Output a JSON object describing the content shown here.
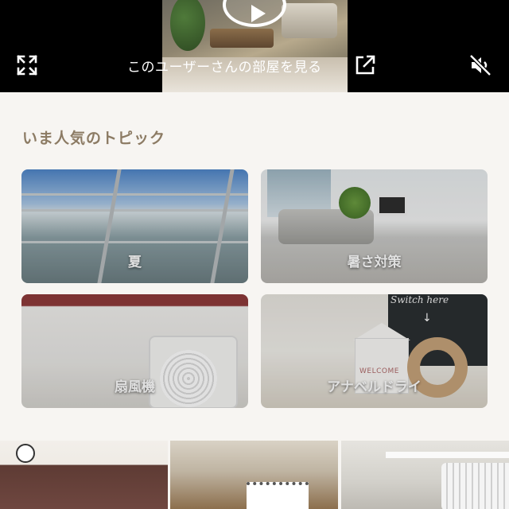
{
  "video": {
    "user_room_link_label": "このユーザーさんの部屋を見る",
    "expand_icon": "expand-icon",
    "external_link_icon": "external-link-icon",
    "mute_icon": "speaker-muted-icon",
    "play_icon": "play-icon"
  },
  "trending": {
    "title": "いま人気のトピック",
    "topics": [
      {
        "label": "夏"
      },
      {
        "label": "暑さ対策"
      },
      {
        "label": "扇風機"
      },
      {
        "label": "アナベルドライ"
      }
    ]
  },
  "tile_texts": {
    "board": "Switch here",
    "arrow": "↓",
    "welcome": "WELCOME"
  },
  "colors": {
    "section_title": "#8c7b64",
    "background": "#f7f5f2",
    "video_bar": "#000000"
  }
}
